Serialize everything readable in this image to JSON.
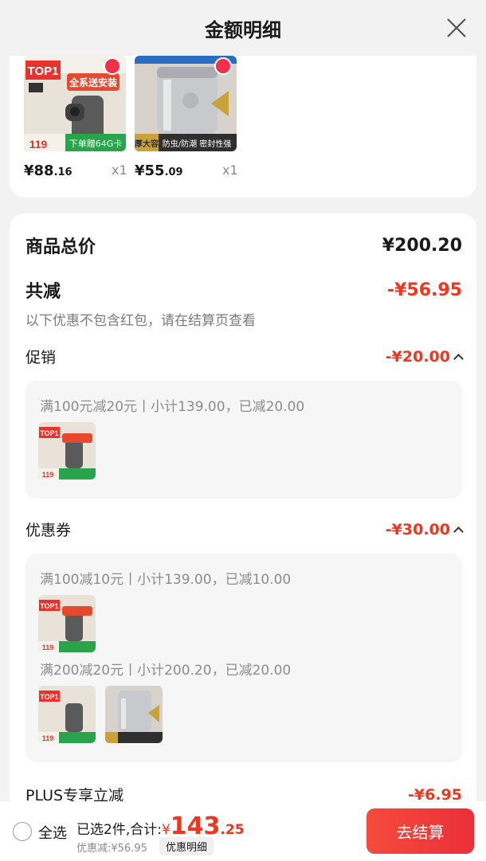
{
  "header": {
    "title": "金额明细"
  },
  "products": [
    {
      "price_int": "¥88",
      "price_dec": ".16",
      "qty": "x1",
      "badge": "TOP1",
      "promo": "全系送安装",
      "gift": "下单赠64G卡",
      "tag_price": "119"
    },
    {
      "price_int": "¥55",
      "price_dec": ".09",
      "qty": "x1",
      "badge": "加厚大容量",
      "promo": "防虫/防潮 密封性强"
    }
  ],
  "totals": {
    "goods_total_label": "商品总价",
    "goods_total_value": "¥200.20",
    "reduce_label": "共减",
    "reduce_value": "-¥56.95",
    "note": "以下优惠不包含红包，请在结算页查看"
  },
  "promotion": {
    "label": "促销",
    "value": "-¥20.00",
    "rule": "满100元减20元丨小计139.00，已减20.00"
  },
  "coupon": {
    "label": "优惠券",
    "value": "-¥30.00",
    "rule1": "满100减10元丨小计139.00，已减10.00",
    "rule2": "满200减20元丨小计200.20，已减20.00"
  },
  "plus": {
    "label": "PLUS专享立减",
    "value": "-¥6.95"
  },
  "bottom": {
    "select_all": "全选",
    "selected_text": "已选2件,合计:",
    "currency": "¥",
    "total_int": "143",
    "total_dec": ".25",
    "discount_text": "优惠减:¥56.95",
    "detail_button": "优惠明细",
    "checkout_button": "去结算"
  },
  "colors": {
    "accent": "#f0361f",
    "checkout": "#ea2f3a"
  }
}
